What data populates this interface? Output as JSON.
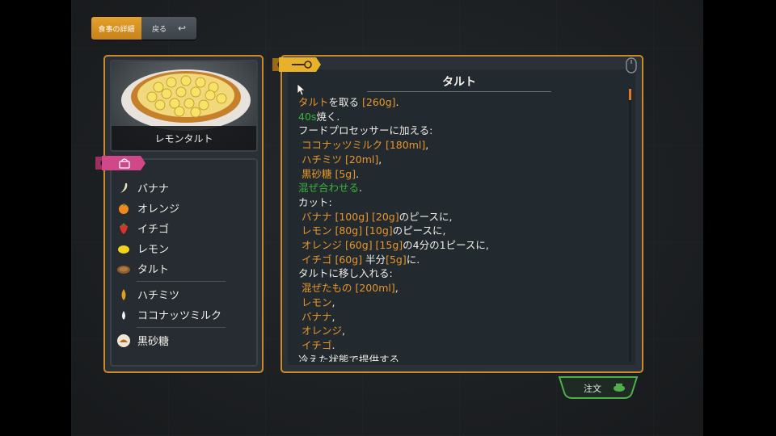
{
  "tabs": {
    "detail_label": "食事の詳細",
    "back_label": "戻る"
  },
  "food": {
    "name": "レモンタルト"
  },
  "ingredients": {
    "group1": [
      {
        "name": "バナナ",
        "icon": "banana-icon"
      },
      {
        "name": "オレンジ",
        "icon": "orange-icon"
      },
      {
        "name": "イチゴ",
        "icon": "strawberry-icon"
      },
      {
        "name": "レモン",
        "icon": "lemon-icon"
      },
      {
        "name": "タルト",
        "icon": "tart-crust-icon"
      }
    ],
    "group2": [
      {
        "name": "ハチミツ",
        "icon": "honey-drop-icon"
      },
      {
        "name": "ココナッツミルク",
        "icon": "milk-drop-icon"
      }
    ],
    "group3": [
      {
        "name": "黒砂糖",
        "icon": "brown-sugar-icon"
      }
    ]
  },
  "recipe": {
    "title": "タルト",
    "lines": [
      [
        {
          "t": "タルト",
          "c": "o"
        },
        {
          "t": "を取る "
        },
        {
          "t": "[260g]",
          "c": "o"
        },
        {
          "t": "."
        }
      ],
      [
        {
          "t": "40s",
          "c": "g"
        },
        {
          "t": "焼く."
        }
      ],
      [
        {
          "t": "フードプロセッサーに加える:"
        }
      ],
      [
        {
          "t": "ココナッツミルク [180ml]",
          "c": "o"
        },
        {
          "t": ","
        }
      ],
      [
        {
          "t": "ハチミツ [20ml]",
          "c": "o"
        },
        {
          "t": ","
        }
      ],
      [
        {
          "t": "黒砂糖 [5g]",
          "c": "o"
        },
        {
          "t": "."
        }
      ],
      [
        {
          "t": "混ぜ合わせる",
          "c": "g"
        },
        {
          "t": "."
        }
      ],
      [
        {
          "t": "カット:"
        }
      ],
      [
        {
          "t": "バナナ [100g] [20g]",
          "c": "o"
        },
        {
          "t": "のピースに,"
        }
      ],
      [
        {
          "t": "レモン [80g] [10g]",
          "c": "o"
        },
        {
          "t": "のピースに,"
        }
      ],
      [
        {
          "t": "オレンジ [60g] [15g]",
          "c": "o"
        },
        {
          "t": "の4分の1ピースに,"
        }
      ],
      [
        {
          "t": "イチゴ [60g]",
          "c": "o"
        },
        {
          "t": " 半分"
        },
        {
          "t": "[5g]",
          "c": "o"
        },
        {
          "t": "に."
        }
      ],
      [
        {
          "t": "タルトに移し入れる:"
        }
      ],
      [
        {
          "t": "混ぜたもの [200ml]",
          "c": "o"
        },
        {
          "t": ","
        }
      ],
      [
        {
          "t": "レモン",
          "c": "o"
        },
        {
          "t": ","
        }
      ],
      [
        {
          "t": "バナナ",
          "c": "o"
        },
        {
          "t": ","
        }
      ],
      [
        {
          "t": "オレンジ",
          "c": "o"
        },
        {
          "t": ","
        }
      ],
      [
        {
          "t": "イチゴ",
          "c": "o"
        },
        {
          "t": "."
        }
      ],
      [
        {
          "t": "冷えた状態で提供する."
        }
      ]
    ],
    "indented": [
      3,
      4,
      5,
      8,
      9,
      10,
      11,
      13,
      14,
      15,
      16,
      17
    ]
  },
  "order": {
    "label": "注文"
  },
  "colors": {
    "accent_orange": "#e8962b",
    "action_green": "#3bb23a",
    "frame_gold": "#c98a2b"
  }
}
